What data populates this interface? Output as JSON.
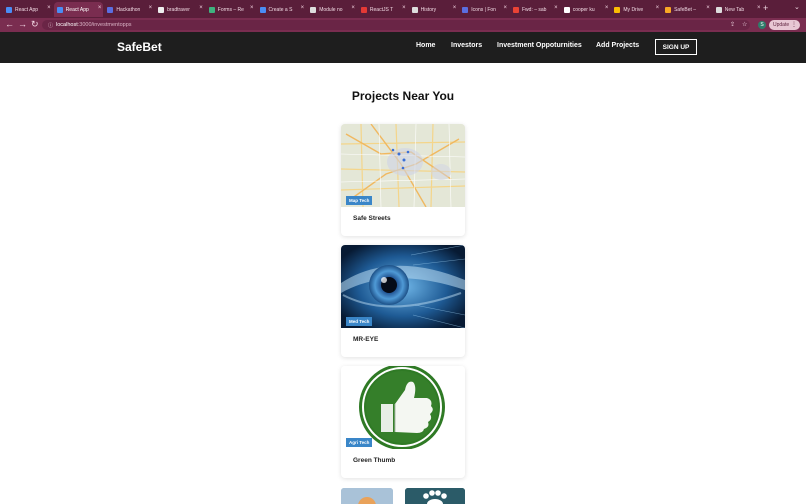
{
  "browser": {
    "tabs": [
      {
        "label": "React App",
        "color": "#4a8df6"
      },
      {
        "label": "React App",
        "color": "#4a8df6",
        "active": true
      },
      {
        "label": "Hackathon",
        "color": "#5b6ee1"
      },
      {
        "label": "bradtraver",
        "color": "#eeeeee"
      },
      {
        "label": "Forms – Re",
        "color": "#3fb27f"
      },
      {
        "label": "Create a S",
        "color": "#4a8df6"
      },
      {
        "label": "Module no",
        "color": "#dddddd"
      },
      {
        "label": "ReactJS T",
        "color": "#e53935"
      },
      {
        "label": "History",
        "color": "#dddddd"
      },
      {
        "label": "Icons | Fon",
        "color": "#5b6ee1"
      },
      {
        "label": "Fwd: – sab",
        "color": "#ea4335"
      },
      {
        "label": "cooper ku",
        "color": "#ffffff"
      },
      {
        "label": "My Drive",
        "color": "#fbbc04"
      },
      {
        "label": "SafeBet –",
        "color": "#f9a825"
      },
      {
        "label": "New Tab",
        "color": "#dddddd"
      }
    ],
    "url_host": "localhost",
    "url_path": ":3000/investmentopps",
    "update_label": "Update",
    "profile_initial": "S"
  },
  "nav": {
    "brand": "SafeBet",
    "links": [
      "Home",
      "Investors",
      "Investment Oppoturnities",
      "Add Projects"
    ],
    "signup": "SIGN UP"
  },
  "main": {
    "heading": "Projects Near You",
    "projects": [
      {
        "title": "Safe Streets",
        "tag": "Map Tech",
        "image": "map-image"
      },
      {
        "title": "MR-EYE",
        "tag": "Med Tech",
        "image": "eye-image"
      },
      {
        "title": "Green Thumb",
        "tag": "Agri Tech",
        "image": "thumbs-up-image"
      }
    ]
  }
}
